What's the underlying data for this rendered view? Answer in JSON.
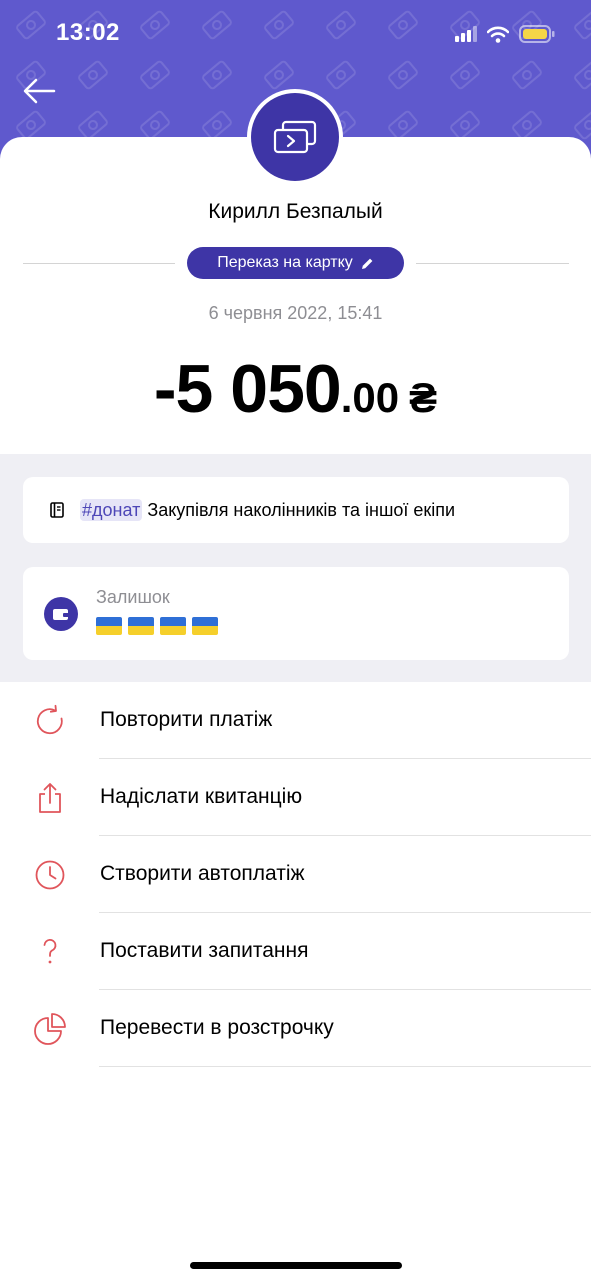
{
  "status_bar": {
    "time": "13:02"
  },
  "transaction": {
    "recipient": "Кирилл Безпалый",
    "category": "Переказ на картку",
    "date": "6 червня 2022, 15:41",
    "amount_main": "-5 050",
    "amount_cents": ".00",
    "currency": "₴"
  },
  "comment": {
    "tag": "#донат",
    "text": " Закупівля наколінників та іншої екіпи"
  },
  "balance": {
    "label": "Залишок",
    "flags_count": 4
  },
  "actions": [
    {
      "label": "Повторити платіж",
      "icon": "repeat-icon"
    },
    {
      "label": "Надіслати квитанцію",
      "icon": "share-icon"
    },
    {
      "label": "Створити автоплатіж",
      "icon": "clock-icon"
    },
    {
      "label": "Поставити запитання",
      "icon": "question-icon"
    },
    {
      "label": "Перевести в розстрочку",
      "icon": "pie-chart-icon"
    }
  ],
  "colors": {
    "header": "#5f59cd",
    "accent": "#3e35a6",
    "action_icon": "#e0555b"
  }
}
